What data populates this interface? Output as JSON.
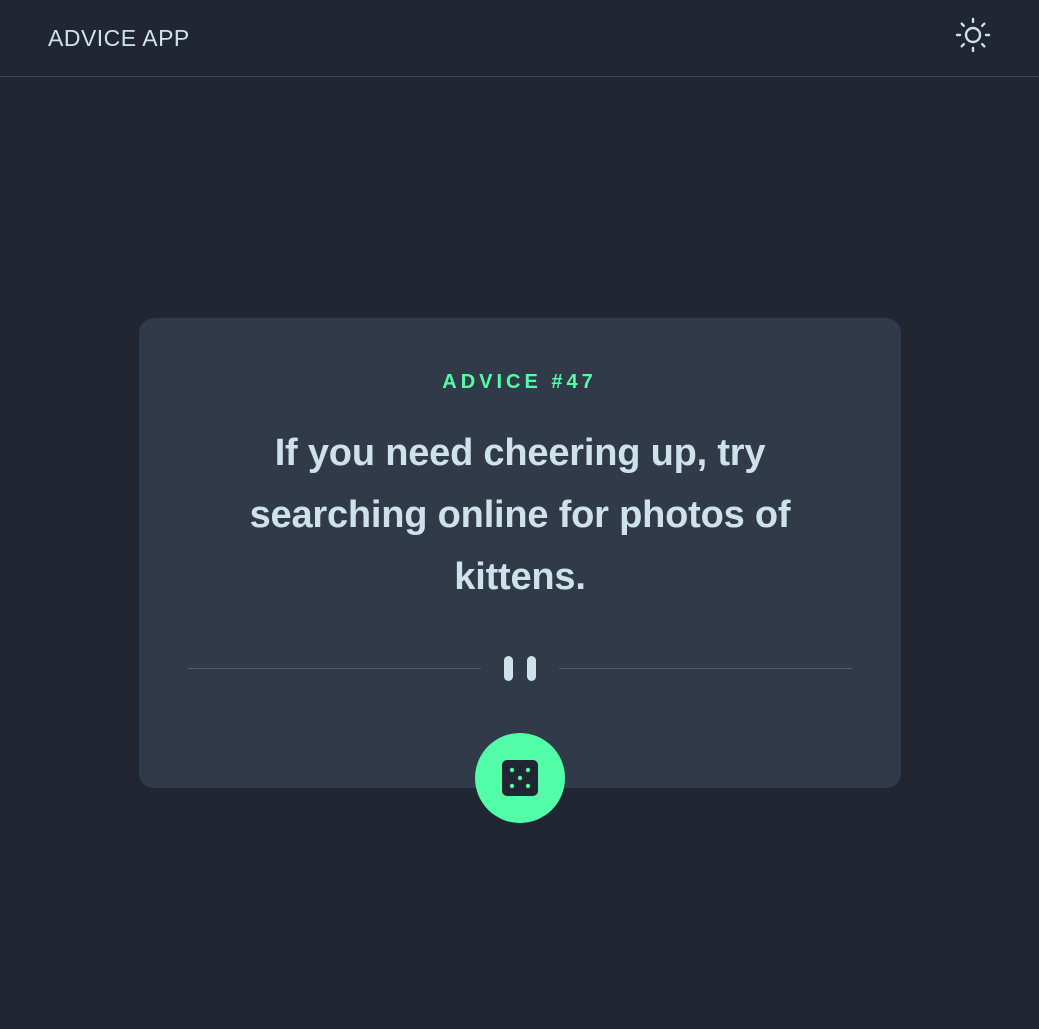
{
  "header": {
    "title": "ADVICE APP",
    "theme_icon": "sun-icon"
  },
  "advice": {
    "label": "ADVICE #47",
    "text": "If you need cheering up, try searching online for photos of kittens."
  },
  "divider": {
    "icon": "pause-icon"
  },
  "dice_button": {
    "icon": "dice-icon"
  },
  "colors": {
    "background": "#202632",
    "card": "#313a48",
    "accent": "#52ffa8",
    "text": "#cee3e9",
    "divider": "#4f5d74"
  }
}
